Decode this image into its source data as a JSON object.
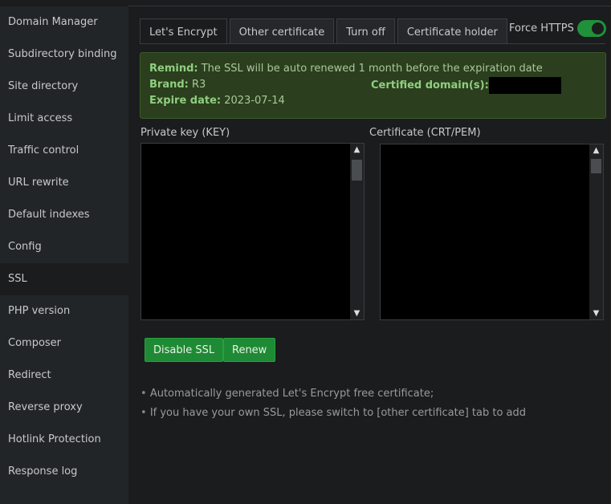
{
  "sidebar": {
    "items": [
      "Domain Manager",
      "Subdirectory binding",
      "Site directory",
      "Limit access",
      "Traffic control",
      "URL rewrite",
      "Default indexes",
      "Config",
      "SSL",
      "PHP version",
      "Composer",
      "Redirect",
      "Reverse proxy",
      "Hotlink Protection",
      "Response log"
    ],
    "active": "SSL"
  },
  "tabs": [
    "Let's Encrypt",
    "Other certificate",
    "Turn off",
    "Certificate holder"
  ],
  "force_https": {
    "label": "Force HTTPS",
    "on": true
  },
  "alert": {
    "remind_label": "Remind:",
    "remind_text": "The SSL will be auto renewed 1 month before the expiration date",
    "brand_label": "Brand:",
    "brand": "R3",
    "domains_label": "Certified domain(s):",
    "expire_label": "Expire date:",
    "expire": "2023-07-14"
  },
  "fields": {
    "key_label": "Private key (KEY)",
    "cert_label": "Certificate (CRT/PEM)"
  },
  "buttons": {
    "disable": "Disable SSL",
    "renew": "Renew"
  },
  "tips": [
    "Automatically generated Let's Encrypt free certificate;",
    "If you have your own SSL, please switch to [other certificate] tab to add"
  ],
  "colors": {
    "accent": "#1f8a35",
    "alert_bg": "#2b3e1e"
  }
}
